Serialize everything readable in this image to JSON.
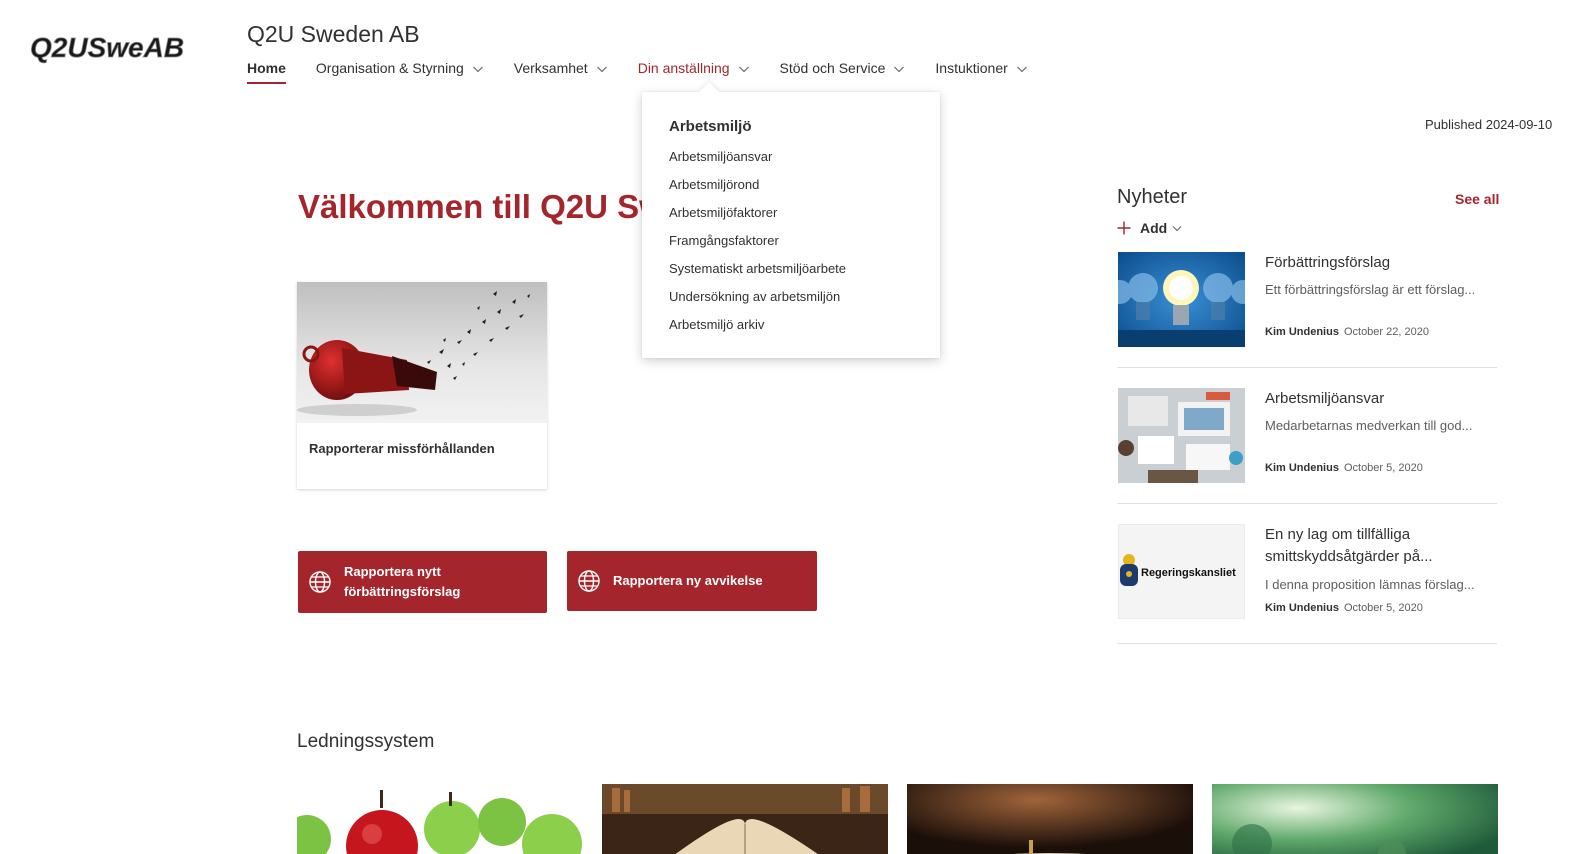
{
  "header": {
    "logo_text": "Q2USweAB",
    "site_title": "Q2U Sweden AB",
    "nav": [
      {
        "label": "Home"
      },
      {
        "label": "Organisation & Styrning"
      },
      {
        "label": "Verksamhet"
      },
      {
        "label": "Din anställning"
      },
      {
        "label": "Stöd och Service"
      },
      {
        "label": "Instuktioner"
      }
    ]
  },
  "dropdown": {
    "heading": "Arbetsmiljö",
    "items": [
      "Arbetsmiljöansvar",
      "Arbetsmiljörond",
      "Arbetsmiljöfaktorer",
      "Framgångsfaktorer",
      "Systematiskt arbetsmiljöarbete",
      "Undersökning av arbetsmiljön",
      "Arbetsmiljö arkiv"
    ]
  },
  "published": "Published 2024-09-10",
  "welcome": "Välkommen till Q2U Sw",
  "card": {
    "label": "Rapporterar missförhållanden"
  },
  "buttons": [
    {
      "label_line1": "Rapportera nytt",
      "label_line2": "förbättringsförslag"
    },
    {
      "label": "Rapportera ny avvikelse"
    }
  ],
  "news": {
    "title": "Nyheter",
    "see_all": "See all",
    "add": "Add",
    "items": [
      {
        "title": "Förbättringsförslag",
        "desc": "Ett förbättringsförslag är ett förslag...",
        "author": "Kim Undenius",
        "date": "October 22, 2020"
      },
      {
        "title": "Arbetsmiljöansvar",
        "desc": "Medarbetarnas medverkan till god...",
        "author": "Kim Undenius",
        "date": "October 5, 2020"
      },
      {
        "title": "En ny lag om tillfälliga smittskyddsåtgärder på...",
        "desc": "I denna proposition lämnas förslag...",
        "author": "Kim Undenius",
        "date": "October 5, 2020",
        "thumb_text": "Regeringskansliet"
      }
    ]
  },
  "section": {
    "title": "Ledningssystem"
  },
  "colors": {
    "accent": "#a4262c",
    "text": "#323130",
    "muted": "#605e5c"
  }
}
